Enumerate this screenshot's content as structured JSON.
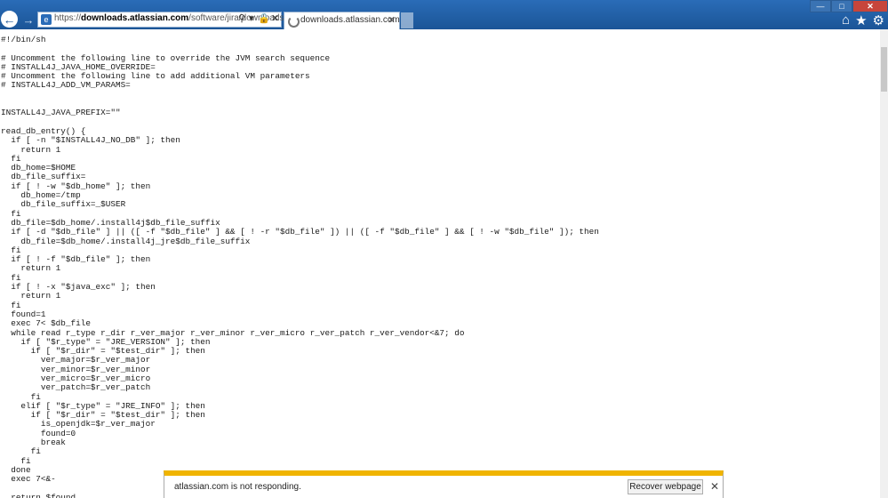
{
  "browser": {
    "address_url": "https://downloads.atlassian.com/software/jira/downloads/",
    "url_prefix": "https://",
    "url_domain": "downloads.atlassian.com",
    "url_path": "/software/jira/downloads/",
    "tab_title": "downloads.atlassian.com",
    "icons": [
      "back-icon",
      "forward-icon",
      "search-icon",
      "lock-icon",
      "refresh-icon",
      "close-icon",
      "home-icon",
      "favorites-icon",
      "gear-icon"
    ]
  },
  "script_text": "#!/bin/sh\n\n# Uncomment the following line to override the JVM search sequence\n# INSTALL4J_JAVA_HOME_OVERRIDE=\n# Uncomment the following line to add additional VM parameters\n# INSTALL4J_ADD_VM_PARAMS=\n\n\nINSTALL4J_JAVA_PREFIX=\"\"\n\nread_db_entry() {\n  if [ -n \"$INSTALL4J_NO_DB\" ]; then\n    return 1\n  fi\n  db_home=$HOME\n  db_file_suffix=\n  if [ ! -w \"$db_home\" ]; then\n    db_home=/tmp\n    db_file_suffix=_$USER\n  fi\n  db_file=$db_home/.install4j$db_file_suffix\n  if [ -d \"$db_file\" ] || ([ -f \"$db_file\" ] && [ ! -r \"$db_file\" ]) || ([ -f \"$db_file\" ] && [ ! -w \"$db_file\" ]); then\n    db_file=$db_home/.install4j_jre$db_file_suffix\n  fi\n  if [ ! -f \"$db_file\" ]; then\n    return 1\n  fi\n  if [ ! -x \"$java_exc\" ]; then\n    return 1\n  fi\n  found=1\n  exec 7< $db_file\n  while read r_type r_dir r_ver_major r_ver_minor r_ver_micro r_ver_patch r_ver_vendor<&7; do\n    if [ \"$r_type\" = \"JRE_VERSION\" ]; then\n      if [ \"$r_dir\" = \"$test_dir\" ]; then\n        ver_major=$r_ver_major\n        ver_minor=$r_ver_minor\n        ver_micro=$r_ver_micro\n        ver_patch=$r_ver_patch\n      fi\n    elif [ \"$r_type\" = \"JRE_INFO\" ]; then\n      if [ \"$r_dir\" = \"$test_dir\" ]; then\n        is_openjdk=$r_ver_major\n        found=0\n        break\n      fi\n    fi\n  done\n  exec 7<&-\n\n  return $found\n}",
  "notification": {
    "message": "atlassian.com is not responding.",
    "button_label": "Recover webpage"
  },
  "colors": {
    "chrome": "#1f5fa6",
    "notification_bar": "#f0b400"
  }
}
